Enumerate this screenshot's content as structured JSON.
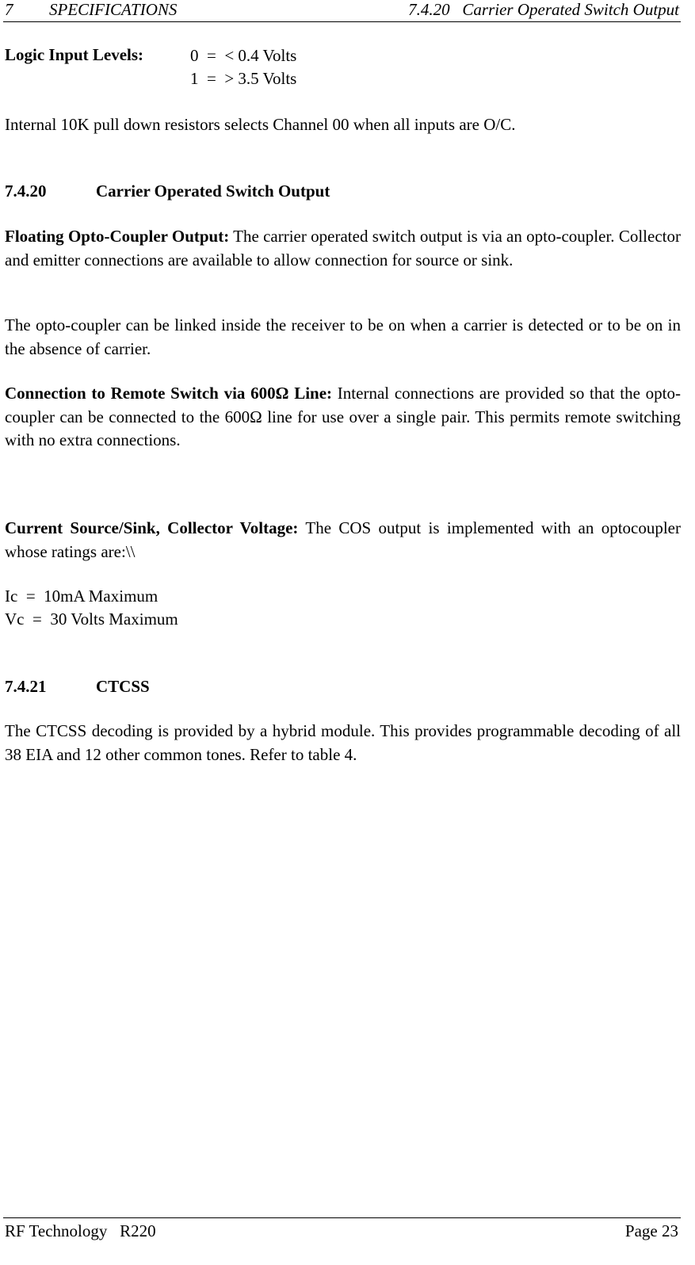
{
  "header": {
    "chapter_number": "7",
    "chapter_title": "SPECIFICATIONS",
    "section_ref": "7.4.20   Carrier Operated Switch Output"
  },
  "logic_levels": {
    "label": "Logic Input Levels:",
    "rows": [
      "0  =  < 0.4 Volts",
      "1  =  > 3.5 Volts"
    ]
  },
  "pulldown_text": "Internal 10K pull down resistors selects Channel 00 when all inputs are O/C.",
  "section_7420": {
    "number": "7.4.20",
    "title": "Carrier Operated Switch Output",
    "floating": {
      "label": "Floating Opto-Coupler Output:",
      "text": " The carrier operated switch output is via an opto-coupler. Collector and emitter connections are available to allow connection for source or sink."
    },
    "linked_text": "The opto-coupler can be linked inside the receiver to be on when a carrier is detected or to be on in the absence of carrier.",
    "remote": {
      "label": "Connection to Remote Switch via 600Ω Line:",
      "text": " Internal connections are provided so that the opto-coupler can be connected to the 600Ω line for use over a single pair. This permits remote switching with no extra connections."
    },
    "current": {
      "label": "Current Source/Sink, Collector Voltage:",
      "text": "  The COS output is implemented with an optocoupler whose ratings are:\\\\"
    },
    "ratings": [
      "Ic  =  10mA Maximum",
      "Vc  =  30 Volts Maximum"
    ]
  },
  "section_7421": {
    "number": "7.4.21",
    "title": "CTCSS",
    "text": "The CTCSS decoding is provided by a hybrid module. This provides programmable decoding of all 38 EIA  and 12 other common tones.  Refer to table 4."
  },
  "footer": {
    "left": "RF Technology   R220",
    "right": "Page 23"
  }
}
